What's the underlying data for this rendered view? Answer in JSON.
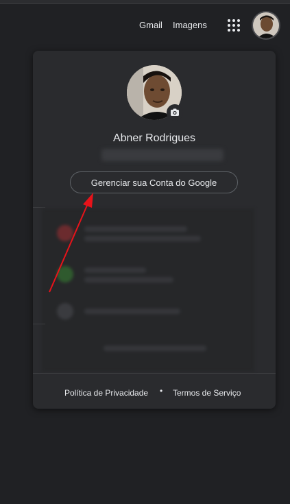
{
  "header": {
    "gmail_label": "Gmail",
    "images_label": "Imagens",
    "apps_icon": "apps-grid-icon",
    "avatar_icon": "user-avatar-icon"
  },
  "account_card": {
    "user_name": "Abner Rodrigues",
    "manage_account_label": "Gerenciar sua Conta do Google",
    "camera_icon": "camera-icon"
  },
  "footer": {
    "privacy_label": "Política de Privacidade",
    "bullet": "•",
    "terms_label": "Termos de Serviço"
  },
  "colors": {
    "background": "#202124",
    "card": "#2a2b2e",
    "text": "#e8eaed",
    "button_border": "#5f6368",
    "annotation_arrow": "#e8131a"
  }
}
